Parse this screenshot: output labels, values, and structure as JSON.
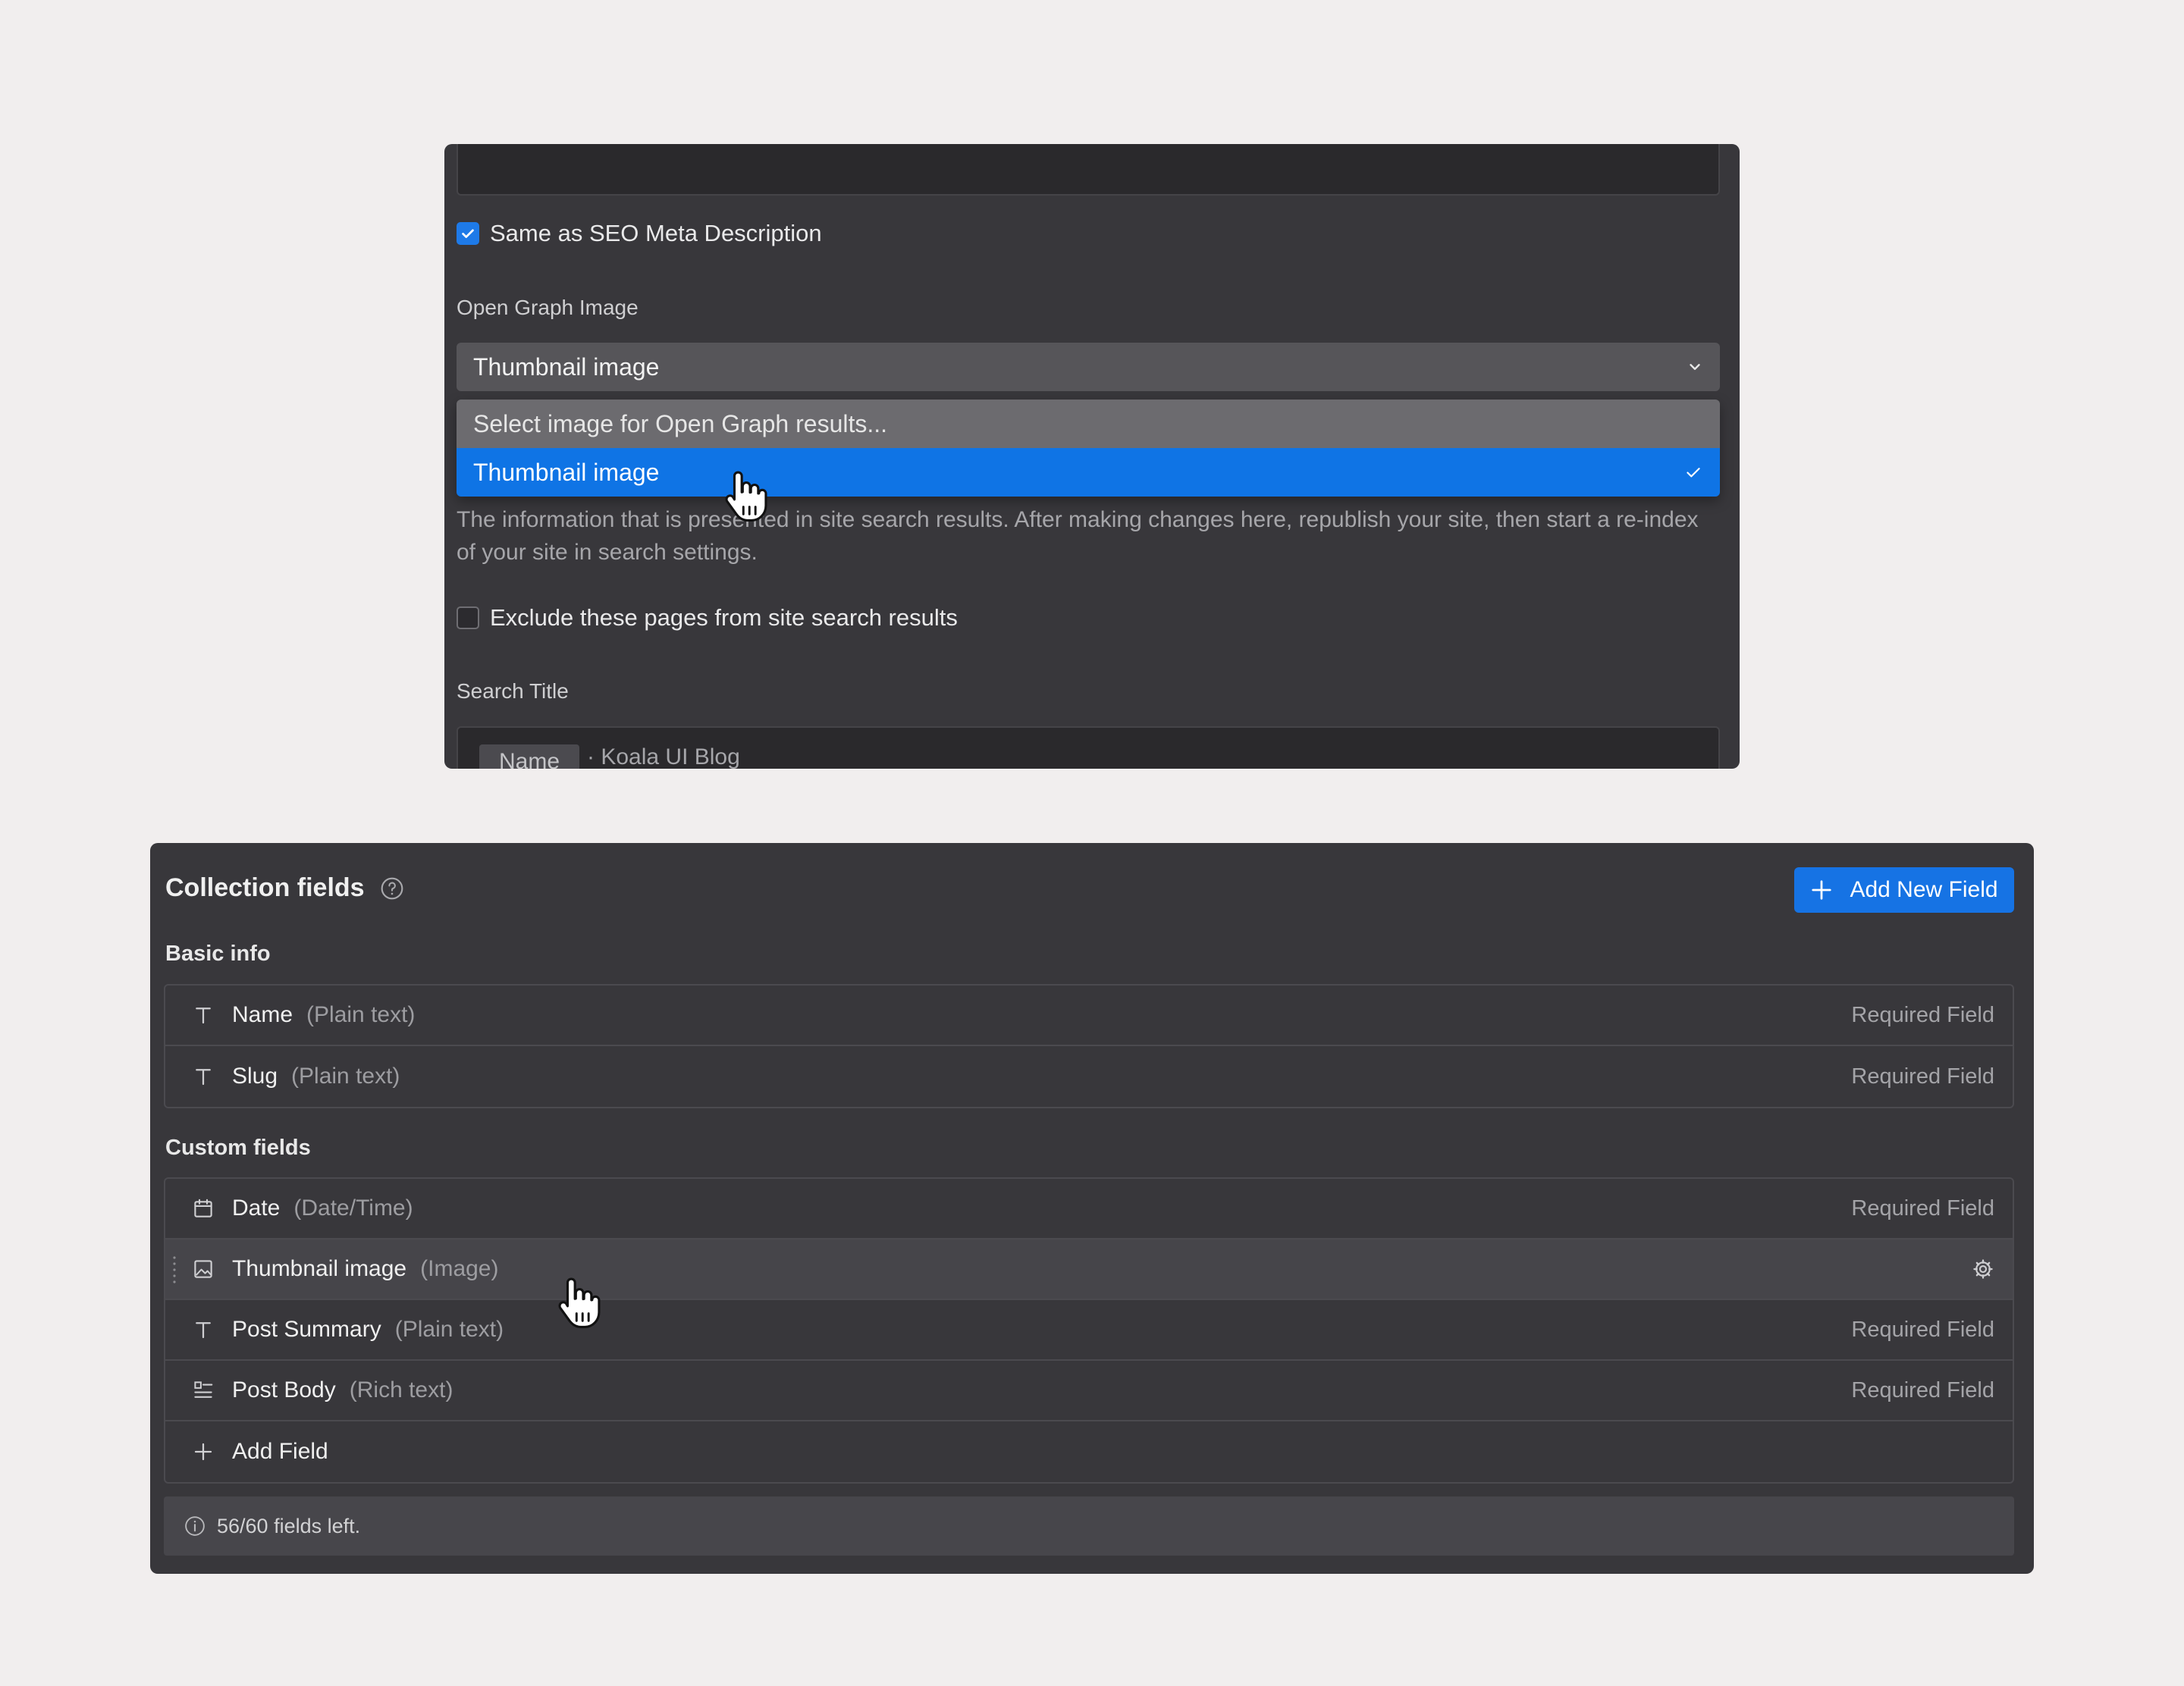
{
  "seo_panel": {
    "same_as_seo_label": "Same as SEO Meta Description",
    "same_as_seo_checked": true,
    "og_image_label": "Open Graph Image",
    "og_image_value": "Thumbnail image",
    "dropdown": {
      "placeholder": "Select image for Open Graph results...",
      "selected_option": "Thumbnail image"
    },
    "search_description": "The information that is presented in site search results. After making changes here, republish your site, then start a re-index of your site in search settings.",
    "exclude_label": "Exclude these pages from site search results",
    "exclude_checked": false,
    "search_title_label": "Search Title",
    "search_title": {
      "token": "Name",
      "suffix": "· Koala UI Blog"
    }
  },
  "collection_panel": {
    "title": "Collection fields",
    "add_new_field_label": "Add New Field",
    "basic_info": {
      "heading": "Basic info",
      "fields": [
        {
          "name": "Name",
          "type": "(Plain text)",
          "status": "Required Field",
          "icon": "text-type-icon"
        },
        {
          "name": "Slug",
          "type": "(Plain text)",
          "status": "Required Field",
          "icon": "text-type-icon"
        }
      ]
    },
    "custom_fields": {
      "heading": "Custom fields",
      "fields": [
        {
          "name": "Date",
          "type": "(Date/Time)",
          "status": "Required Field",
          "icon": "calendar-icon"
        },
        {
          "name": "Thumbnail image",
          "type": "(Image)",
          "status": "",
          "icon": "image-icon"
        },
        {
          "name": "Post Summary",
          "type": "(Plain text)",
          "status": "Required Field",
          "icon": "text-type-icon"
        },
        {
          "name": "Post Body",
          "type": "(Rich text)",
          "status": "Required Field",
          "icon": "rich-text-icon"
        }
      ],
      "add_field_label": "Add Field"
    },
    "fields_left": "56/60 fields left."
  },
  "colors": {
    "background": "#f1eeee",
    "panel": "#38373b",
    "accent_blue": "#1673e4",
    "dropdown_selected": "#0f74e5"
  }
}
